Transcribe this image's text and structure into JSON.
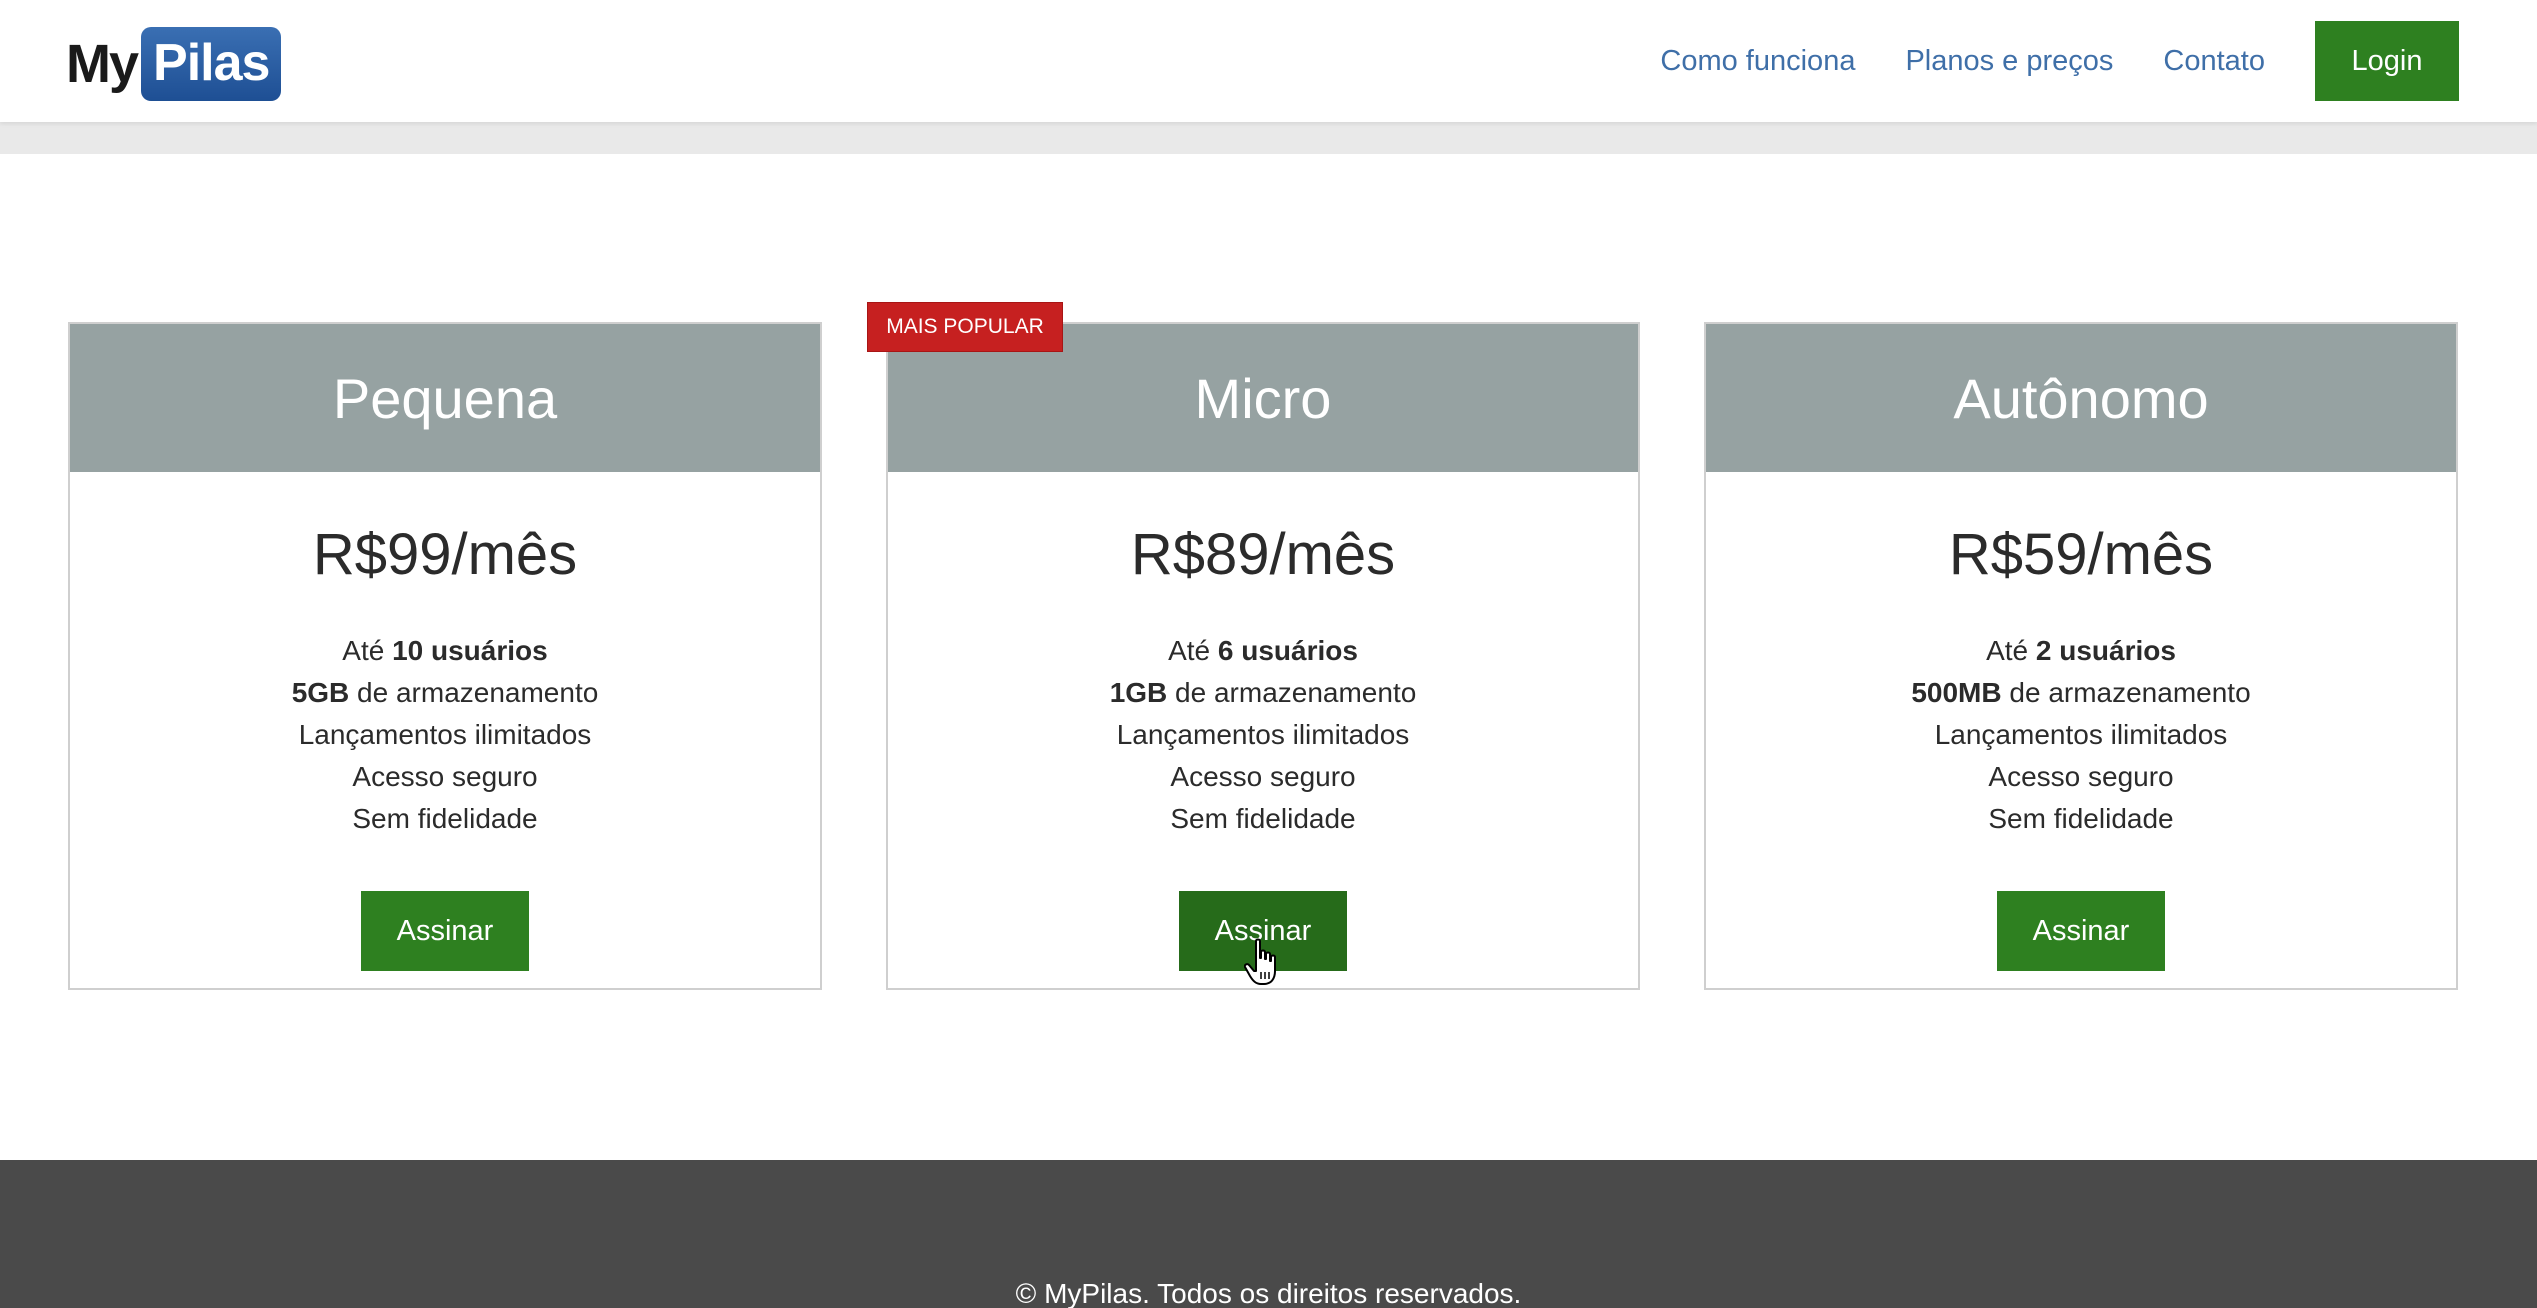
{
  "header": {
    "logo": {
      "part1": "My",
      "part2": "Pilas"
    },
    "nav": [
      "Como funciona",
      "Planos e preços",
      "Contato"
    ],
    "login_label": "Login"
  },
  "badge": "MAIS POPULAR",
  "plans": [
    {
      "name": "Pequena",
      "price": "R$99/mês",
      "users_prefix": "Até ",
      "users": "10 usuários",
      "storage": "5GB",
      "storage_suffix": " de armazenamento",
      "feature3": "Lançamentos ilimitados",
      "feature4": "Acesso seguro",
      "feature5": "Sem fidelidade",
      "button": "Assinar"
    },
    {
      "name": "Micro",
      "price": "R$89/mês",
      "users_prefix": "Até ",
      "users": "6 usuários",
      "storage": "1GB",
      "storage_suffix": " de armazenamento",
      "feature3": "Lançamentos ilimitados",
      "feature4": "Acesso seguro",
      "feature5": "Sem fidelidade",
      "button": "Assinar"
    },
    {
      "name": "Autônomo",
      "price": "R$59/mês",
      "users_prefix": "Até ",
      "users": "2 usuários",
      "storage": "500MB",
      "storage_suffix": " de armazenamento",
      "feature3": "Lançamentos ilimitados",
      "feature4": "Acesso seguro",
      "feature5": "Sem fidelidade",
      "button": "Assinar"
    }
  ],
  "footer": {
    "copyright": "© MyPilas. Todos os direitos reservados."
  },
  "colors": {
    "accent_green": "#2e8020",
    "badge_red": "#c62020",
    "card_header": "#96a2a2",
    "link_blue": "#3f6fa8",
    "footer_bg": "#4a4a4a"
  },
  "icons": {
    "cursor": "hand-pointer-icon"
  }
}
